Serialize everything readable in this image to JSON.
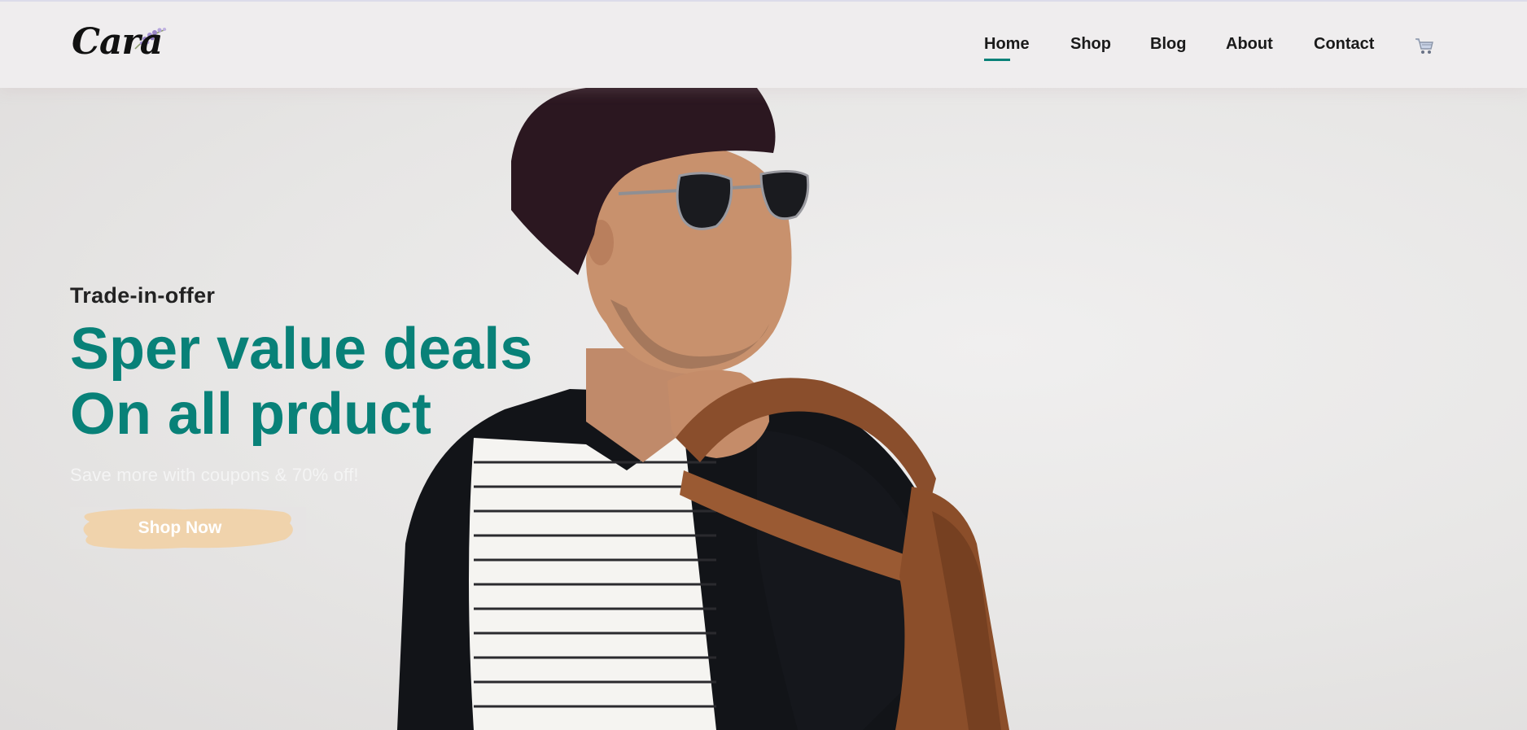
{
  "brand": {
    "name": "Cara",
    "accent_color": "#088178",
    "button_color": "#f0d3ac"
  },
  "nav": {
    "items": [
      {
        "label": "Home",
        "active": true
      },
      {
        "label": "Shop",
        "active": false
      },
      {
        "label": "Blog",
        "active": false
      },
      {
        "label": "About",
        "active": false
      },
      {
        "label": "Contact",
        "active": false
      }
    ],
    "cart_icon": "cart-icon"
  },
  "hero": {
    "eyebrow": "Trade-in-offer",
    "headline_line1": "Sper value deals",
    "headline_line2": "On all prduct",
    "subtext": "Save more with coupons & 70% off!",
    "cta_label": "Shop Now"
  }
}
